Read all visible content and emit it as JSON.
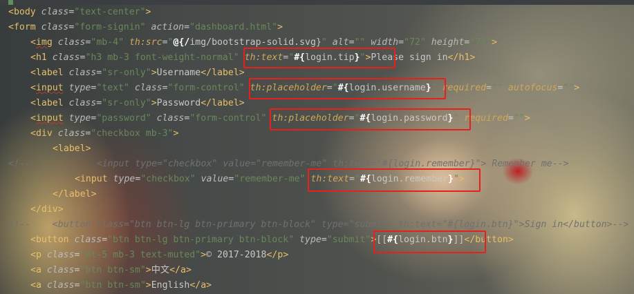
{
  "lines": [
    {
      "parts": [
        "<",
        "body",
        " class",
        "=",
        "\"text-center\"",
        ">"
      ]
    },
    {
      "parts": [
        "<",
        "form",
        " class",
        "=",
        "\"form-signin\"",
        " action",
        "=",
        "\"dashboard.html\"",
        ">"
      ]
    },
    {
      "parts": [
        "<",
        "img",
        " class",
        "=",
        "\"mb-4\"",
        " th:src",
        "=",
        "\"",
        "@{/",
        "img/bootstrap-solid.svg}",
        "\"",
        " alt",
        "=",
        "\"\"",
        " width",
        "=",
        "\"72\"",
        " height",
        "=",
        "\"72\"",
        ">"
      ]
    },
    {
      "parts": [
        "<",
        "h1",
        " class",
        "=",
        "\"h3 mb-3 font-weight-normal\"",
        " th:text",
        "=",
        "\"",
        "#{",
        "login.tip",
        "}",
        "\"",
        ">",
        "Please sign in",
        "</",
        "h1",
        ">"
      ]
    },
    {
      "parts": [
        "<",
        "label",
        " class",
        "=",
        "\"sr-only\"",
        ">",
        "Username",
        "</",
        "label",
        ">"
      ]
    },
    {
      "parts": [
        "<",
        "input",
        " type",
        "=",
        "\"text\"",
        " class",
        "=",
        "\"form-control\"",
        " th:placeholder",
        "=",
        "\"",
        "#{",
        "login.username",
        "}",
        "\"",
        " required",
        "=",
        "\"\"",
        " autofocus",
        "=",
        "\"\"",
        ">"
      ]
    },
    {
      "parts": [
        "<",
        "label",
        " class",
        "=",
        "\"sr-only\"",
        ">",
        "Password",
        "</",
        "label",
        ">"
      ]
    },
    {
      "parts": [
        "<",
        "input",
        " type",
        "=",
        "\"password\"",
        " class",
        "=",
        "\"form-control\"",
        " th:placeholder",
        "=",
        "\"",
        "#{",
        "login.password",
        "}",
        "\"",
        " required",
        "=",
        "\"\"",
        ">"
      ]
    },
    {
      "parts": [
        "<",
        "div",
        " class",
        "=",
        "\"checkbox mb-3\"",
        ">"
      ]
    },
    {
      "parts": [
        "<",
        "label",
        ">"
      ]
    },
    {
      "parts": [
        "<!--",
        "<input type=\"checkbox\" value=\"remember-me\" th:text=\"#{login.remember}\"> Remember me-->"
      ]
    },
    {
      "parts": [
        "<",
        "input",
        " type",
        "=",
        "\"checkbox\"",
        " value",
        "=",
        "\"remember-me\"",
        " th:text",
        "=",
        "\"",
        "#{",
        "login.remember",
        "}",
        "\"",
        ">"
      ]
    },
    {
      "parts": [
        "</",
        "label",
        ">"
      ]
    },
    {
      "parts": [
        "</",
        "div",
        ">"
      ]
    },
    {
      "parts": [
        "<!--",
        "<button class=\"btn btn-lg btn-primary btn-block\" type=\"submit\" th:text=\"#{login.btn}\">Sign in</button>-->"
      ]
    },
    {
      "parts": [
        "<",
        "button",
        " class",
        "=",
        "\"btn btn-lg btn-primary btn-block\"",
        " type",
        "=",
        "\"submit\"",
        ">",
        "[[",
        "#{",
        "login.btn",
        "}",
        "]]",
        "</",
        "button",
        ">"
      ]
    },
    {
      "parts": [
        "<",
        "p",
        " class",
        "=",
        "\"mt-5 mb-3 text-muted\"",
        ">",
        "© 2017-2018",
        "</",
        "p",
        ">"
      ]
    },
    {
      "parts": [
        "<",
        "a",
        " class",
        "=",
        "\"btn btn-sm\"",
        ">",
        "中文",
        "</",
        "a",
        ">"
      ]
    },
    {
      "parts": [
        "<",
        "a",
        " class",
        "=",
        "\"btn btn-sm\"",
        ">",
        "English",
        "</",
        "a",
        ">"
      ]
    }
  ]
}
